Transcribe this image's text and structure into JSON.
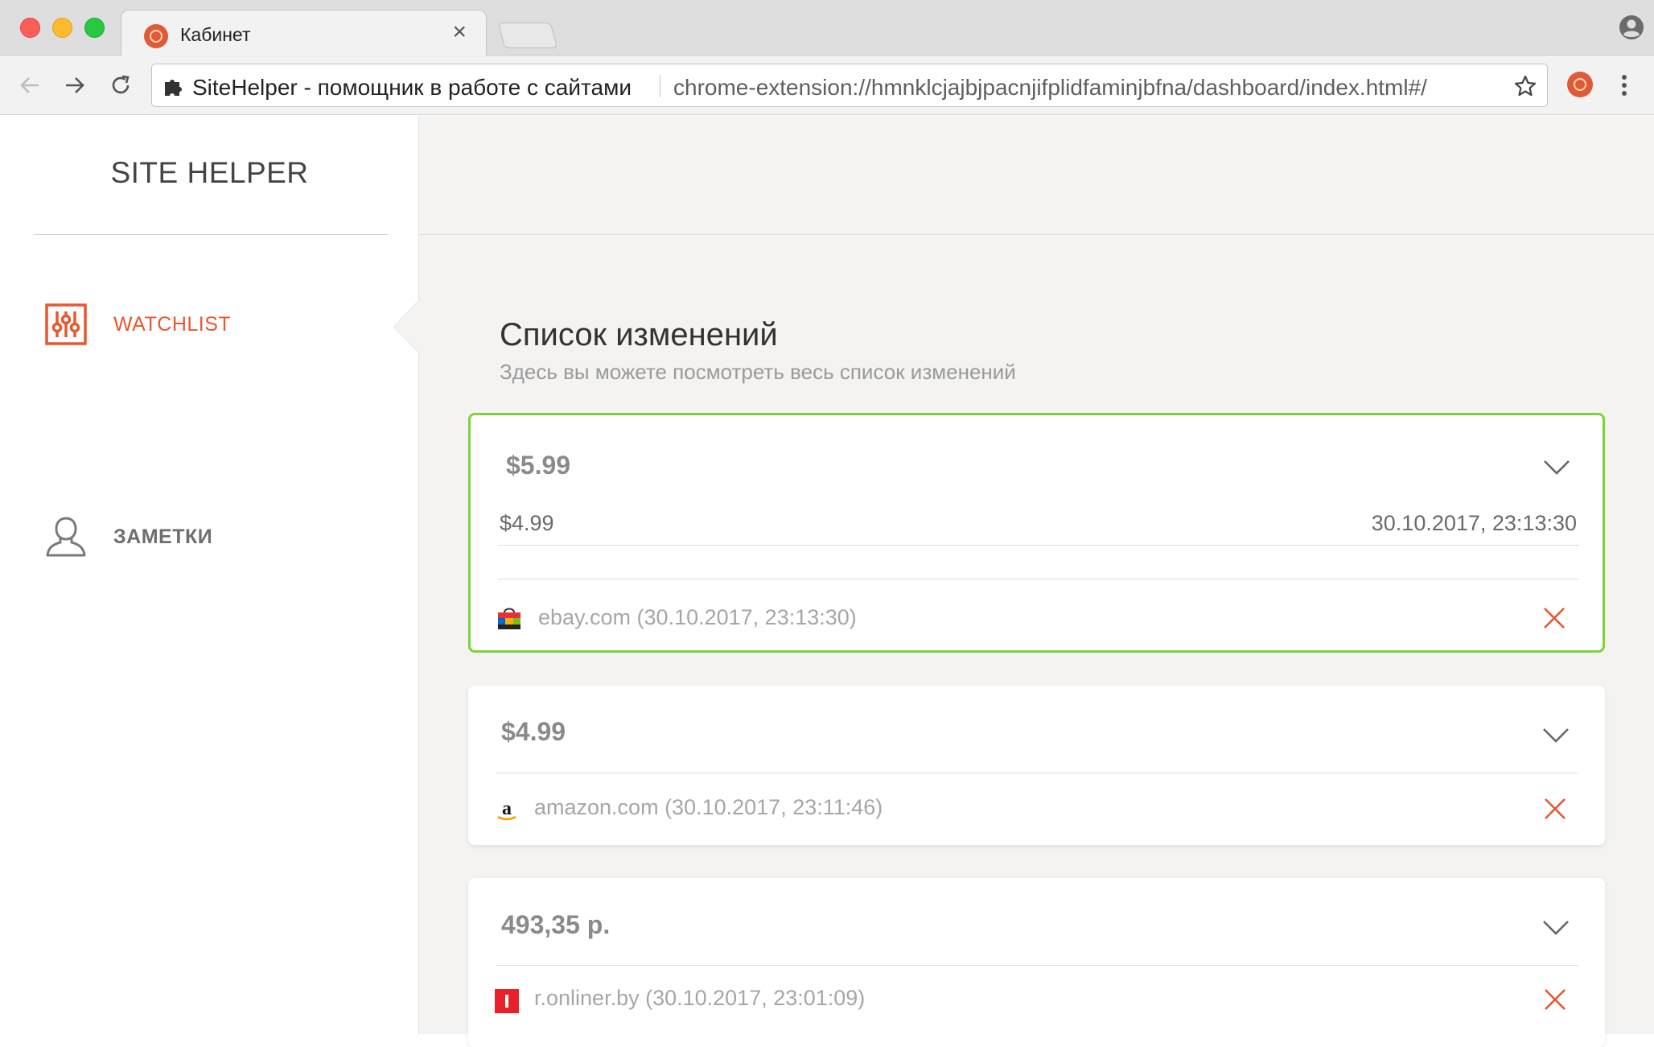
{
  "browser": {
    "tab_title": "Кабинет",
    "tab_close": "×",
    "site_name": "SiteHelper - помощник в работе с сайтами",
    "url": "chrome-extension://hmnklcjajbjpacnjifplidfaminjbfna/dashboard/index.html#/",
    "favicon_color": "#e05a3a"
  },
  "sidebar": {
    "brand": "SITE HELPER",
    "items": [
      {
        "label": "WATCHLIST",
        "icon": "sliders-icon",
        "active": true
      },
      {
        "label": "ЗАМЕТКИ",
        "icon": "user-icon",
        "active": false
      }
    ]
  },
  "main": {
    "title": "Список изменений",
    "subtitle": "Здесь вы можете посмотреть весь список изменений"
  },
  "cards": [
    {
      "price": "$5.99",
      "history_price": "$4.99",
      "history_date": "30.10.2017, 23:13:30",
      "site": "ebay.com (30.10.2017, 23:13:30)",
      "site_icon": "ebay-icon",
      "highlighted": true
    },
    {
      "price": "$4.99",
      "site": "amazon.com (30.10.2017, 23:11:46)",
      "site_icon": "amazon-icon",
      "highlighted": false
    },
    {
      "price": "493,35 р.",
      "site": "r.onliner.by (30.10.2017, 23:01:09)",
      "site_icon": "onliner-icon",
      "highlighted": false
    }
  ],
  "colors": {
    "accent": "#e6582f",
    "highlight_border": "#7ed33a",
    "page_bg": "#f4f3f1"
  }
}
